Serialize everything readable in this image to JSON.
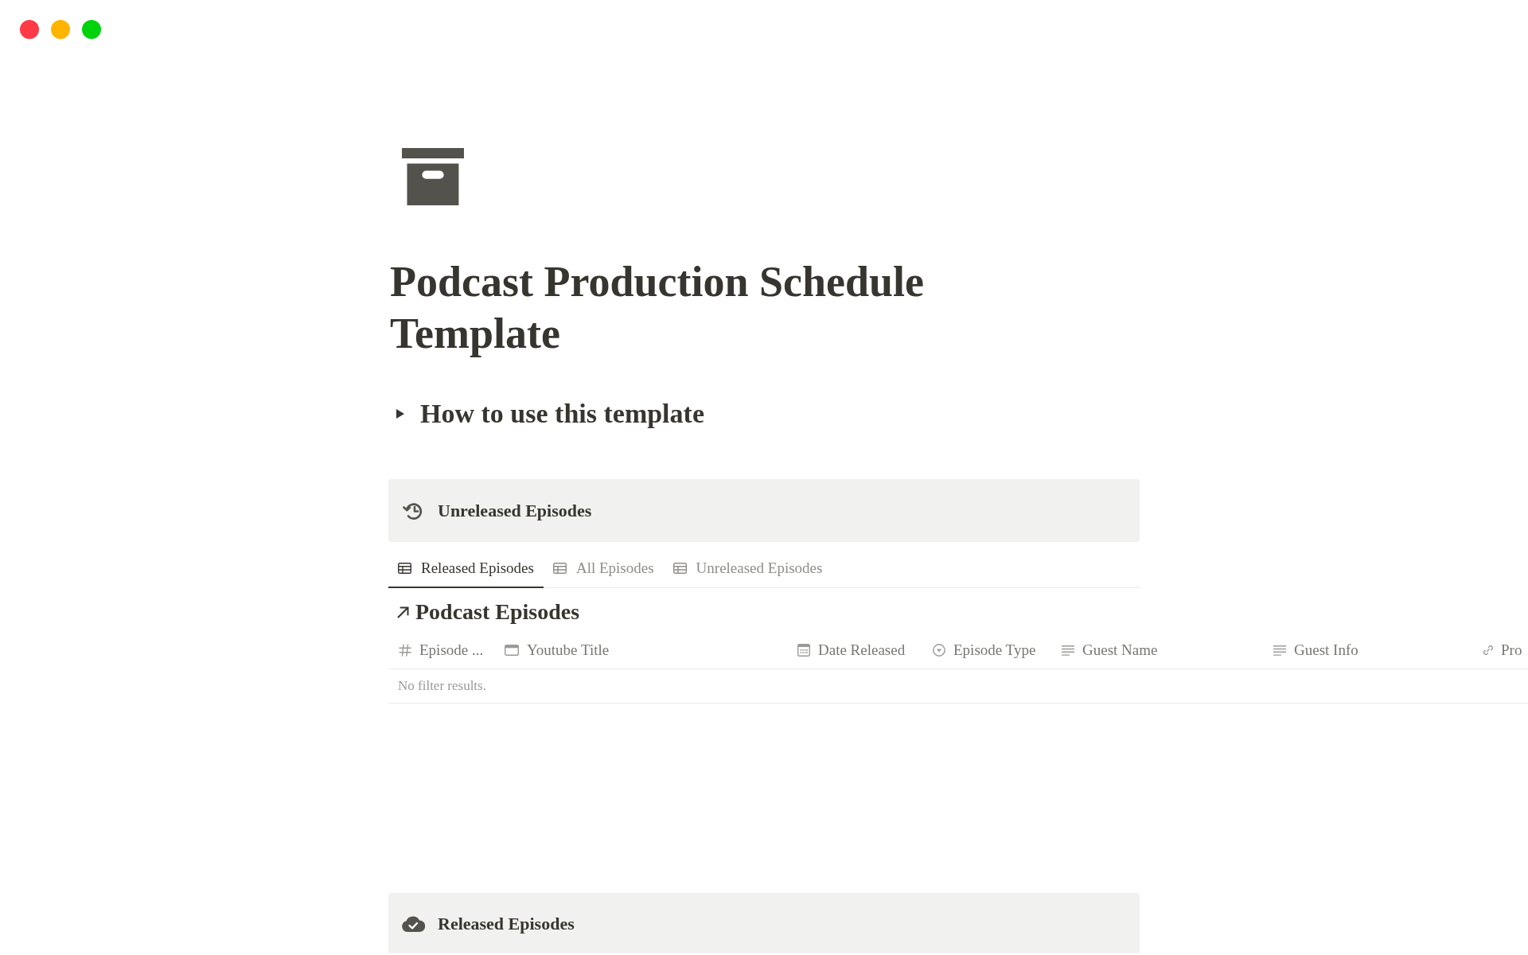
{
  "window_controls": [
    {
      "color": "#fe3a47"
    },
    {
      "color": "#ffb400"
    },
    {
      "color": "#00d20d"
    }
  ],
  "page": {
    "title": "Podcast Production Schedule Template",
    "toggle": {
      "label": "How to use this template",
      "expanded": false
    }
  },
  "unreleased_section": {
    "heading": "Unreleased Episodes",
    "tabs": [
      {
        "label": "Released Episodes",
        "selected": true
      },
      {
        "label": "All Episodes",
        "selected": false
      },
      {
        "label": "Unreleased Episodes",
        "selected": false
      }
    ],
    "database": {
      "title": "Podcast Episodes",
      "columns": [
        {
          "kind": "number",
          "label": "Episode ..."
        },
        {
          "kind": "title",
          "label": "Youtube Title"
        },
        {
          "kind": "date",
          "label": "Date Released"
        },
        {
          "kind": "select",
          "label": "Episode Type"
        },
        {
          "kind": "text",
          "label": "Guest Name"
        },
        {
          "kind": "text",
          "label": "Guest Info"
        },
        {
          "kind": "url",
          "label": "Pro"
        }
      ],
      "empty_message": "No filter results."
    }
  },
  "released_section": {
    "heading": "Released Episodes"
  }
}
